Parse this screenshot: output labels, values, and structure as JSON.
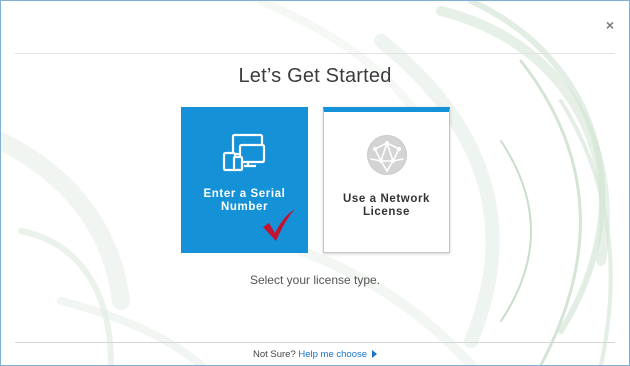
{
  "dialog": {
    "title": "Let’s Get Started",
    "subtitle": "Select your license type.",
    "close_symbol": "×"
  },
  "options": [
    {
      "label": "Enter a Serial Number",
      "icon": "devices-icon",
      "selected": true
    },
    {
      "label": "Use a Network License",
      "icon": "network-globe-icon",
      "selected": false
    }
  ],
  "footer": {
    "prompt": "Not Sure?",
    "link": "Help me choose"
  },
  "colors": {
    "accent": "#1591d8",
    "check": "#c41230",
    "link": "#1a73c9"
  }
}
